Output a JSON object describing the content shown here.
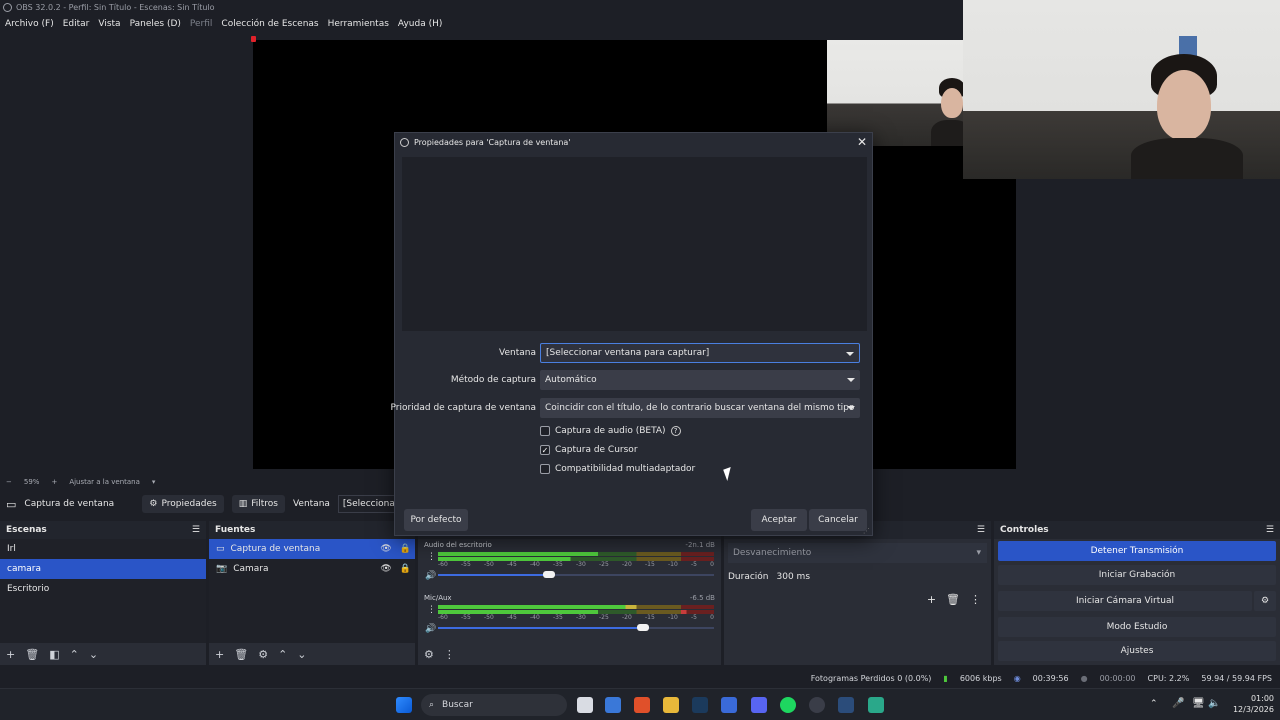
{
  "window": {
    "title": "OBS 32.0.2 - Perfil: Sin Título - Escenas: Sin Título"
  },
  "menu": [
    "Archivo (F)",
    "Editar",
    "Vista",
    "Paneles (D)",
    "Perfil",
    "Colección de Escenas",
    "Herramientas",
    "Ayuda (H)"
  ],
  "zoom": {
    "minus": "−",
    "level": "59%",
    "plus": "+",
    "fit": "Ajustar a la ventana"
  },
  "context": {
    "source": "Captura de ventana",
    "properties": "Propiedades",
    "filters": "Filtros",
    "window_label": "Ventana",
    "window_value": "[Seleccionar ve"
  },
  "dialog": {
    "title": "Propiedades para 'Captura de ventana'",
    "window_label": "Ventana",
    "window_value": "[Seleccionar ventana para capturar]",
    "method_label": "Método de captura",
    "method_value": "Automático",
    "priority_label": "Prioridad de captura de ventana",
    "priority_value": "Coincidir con el título, de lo contrario buscar ventana del mismo tipo",
    "audio_capture": "Captura de audio (BETA)",
    "cursor_capture": "Captura de Cursor",
    "multiadapter": "Compatibilidad multiadaptador",
    "defaults": "Por defecto",
    "ok": "Aceptar",
    "cancel": "Cancelar"
  },
  "scenes": {
    "title": "Escenas",
    "items": [
      "Irl",
      "camara",
      "Escritorio"
    ],
    "selected": 1
  },
  "sources": {
    "title": "Fuentes",
    "items": [
      "Captura de ventana",
      "Camara"
    ]
  },
  "mixer": {
    "channels": [
      {
        "name": "Audio del escritorio",
        "db": "-2n.1 dB"
      },
      {
        "name": "Mic/Aux",
        "db": "-6.5 dB"
      }
    ],
    "ticks": [
      "-60",
      "-55",
      "-50",
      "-45",
      "-40",
      "-35",
      "-30",
      "-25",
      "-20",
      "-15",
      "-10",
      "-5",
      "0"
    ]
  },
  "transitions": {
    "type": "Desvanecimiento",
    "duration_label": "Duración",
    "duration_value": "300 ms"
  },
  "controls": {
    "title": "Controles",
    "stop_stream": "Detener Transmisión",
    "start_record": "Iniciar Grabación",
    "start_virtualcam": "Iniciar Cámara Virtual",
    "studio_mode": "Modo Estudio",
    "settings": "Ajustes"
  },
  "status": {
    "dropped": "Fotogramas Perdidos 0 (0.0%)",
    "bitrate": "6006 kbps",
    "stream_time": "00:39:56",
    "rec_time": "00:00:00",
    "cpu": "CPU: 2.2%",
    "fps": "59.94 / 59.94 FPS"
  },
  "taskbar": {
    "search": "Buscar",
    "time": "01:00",
    "date": "12/3/2026"
  },
  "colors": {
    "accent": "#2a55c7",
    "meter_green": "#4ec83c",
    "meter_yellow": "#c8b43c",
    "meter_red": "#c83c3c"
  }
}
